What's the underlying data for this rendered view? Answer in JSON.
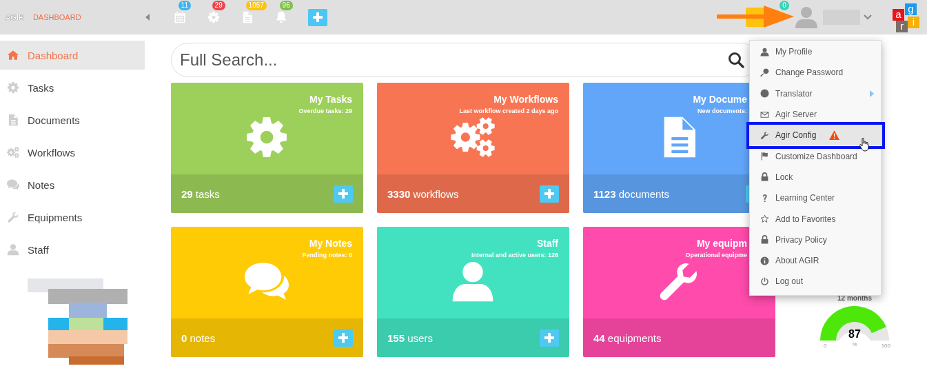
{
  "topbar": {
    "brand": "AGIR",
    "page": "DASHBOARD",
    "notifications": [
      {
        "kind": "calendar",
        "count": "11",
        "color": "#3bb6f0"
      },
      {
        "kind": "gear",
        "count": "29",
        "color": "#f0454a"
      },
      {
        "kind": "document",
        "count": "1057",
        "color": "#ffc20e"
      },
      {
        "kind": "bell",
        "count": "96",
        "color": "#7cc242"
      }
    ],
    "tray_badge": "0",
    "logo": [
      "a",
      "g",
      "r",
      "i"
    ]
  },
  "sidebar": {
    "items": [
      {
        "label": "Dashboard",
        "kind": "home",
        "selected": true
      },
      {
        "label": "Tasks",
        "kind": "gear",
        "selected": false
      },
      {
        "label": "Documents",
        "kind": "document",
        "selected": false
      },
      {
        "label": "Workflows",
        "kind": "gears",
        "selected": false
      },
      {
        "label": "Notes",
        "kind": "chat",
        "selected": false
      },
      {
        "label": "Equipments",
        "kind": "wrench",
        "selected": false
      },
      {
        "label": "Staff",
        "kind": "user",
        "selected": false
      }
    ]
  },
  "search": {
    "placeholder": "Full Search..."
  },
  "cards": [
    {
      "title": "My Tasks",
      "subtitle": "Overdue tasks: 29",
      "count": "29",
      "unit": "tasks",
      "kind": "gear",
      "add_button": true,
      "color": "#9dd05a"
    },
    {
      "title": "My Workflows",
      "subtitle": "Last workflow created 2 days ago",
      "count": "3330",
      "unit": "workflows",
      "kind": "gears",
      "add_button": true,
      "color": "#f87553"
    },
    {
      "title": "My Docume",
      "subtitle": "New documents:",
      "count": "1123",
      "unit": "documents",
      "kind": "document",
      "add_button": true,
      "color": "#62a6f9"
    },
    {
      "title": "My Notes",
      "subtitle": "Pending notes: 0",
      "count": "0",
      "unit": "notes",
      "kind": "chat",
      "add_button": true,
      "color": "#ffcb05"
    },
    {
      "title": "Staff",
      "subtitle": "Internal and active users: 126",
      "count": "155",
      "unit": "users",
      "kind": "user",
      "add_button": true,
      "color": "#42e2c1"
    },
    {
      "title": "My equipm",
      "subtitle": "Operational equipme",
      "count": "44",
      "unit": "equipments",
      "kind": "wrench",
      "add_button": false,
      "color": "#ff4bab"
    }
  ],
  "gauge": {
    "caption": "12 months",
    "value": "87",
    "unit": "%",
    "min": "0",
    "max": "100",
    "level": 0.87
  },
  "user_menu": {
    "items": [
      {
        "label": "My Profile",
        "kind": "user",
        "selected": false,
        "submenu": false,
        "warning": false
      },
      {
        "label": "Change Password",
        "kind": "key",
        "selected": false,
        "submenu": false,
        "warning": false
      },
      {
        "label": "Translator",
        "kind": "globe",
        "selected": false,
        "submenu": true,
        "warning": false
      },
      {
        "label": "Agir Server",
        "kind": "envelope",
        "selected": false,
        "submenu": false,
        "warning": false
      },
      {
        "label": "Agir Config",
        "kind": "wrench",
        "selected": true,
        "submenu": false,
        "warning": true
      },
      {
        "label": "Customize Dashboard",
        "kind": "flag",
        "selected": false,
        "submenu": false,
        "warning": false
      },
      {
        "label": "Lock",
        "kind": "lock",
        "selected": false,
        "submenu": false,
        "warning": false
      },
      {
        "label": "Learning Center",
        "kind": "question",
        "selected": false,
        "submenu": false,
        "warning": false
      },
      {
        "label": "Add to Favorites",
        "kind": "star",
        "selected": false,
        "submenu": false,
        "warning": false
      },
      {
        "label": "Privacy Policy",
        "kind": "lock",
        "selected": false,
        "submenu": false,
        "warning": false
      },
      {
        "label": "About AGIR",
        "kind": "info",
        "selected": false,
        "submenu": false,
        "warning": false
      },
      {
        "label": "Log out",
        "kind": "power",
        "selected": false,
        "submenu": false,
        "warning": false
      }
    ]
  }
}
